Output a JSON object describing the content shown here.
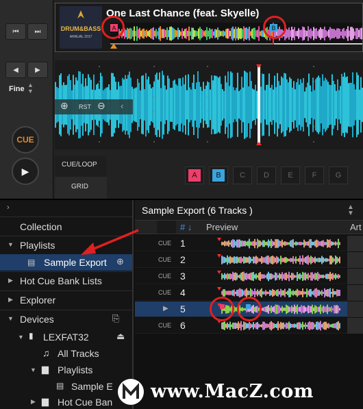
{
  "deck": {
    "transport": {
      "prev_icon": "skip-back-icon",
      "next_icon": "skip-forward-icon",
      "nudge_left_icon": "triangle-left-icon",
      "nudge_right_icon": "triangle-right-icon",
      "fine_label": "Fine",
      "cue_label": "CUE",
      "play_icon": "play-icon"
    },
    "track_title": "One Last Chance (feat. Skyelle)",
    "artwork_text": "DRUM&BASS",
    "artwork_sub": "ANNUAL 2017",
    "overview_markers": [
      "A",
      "B"
    ],
    "zoom": {
      "zoom_in_icon": "zoom-in-icon",
      "reset_label": "RST",
      "zoom_out_icon": "zoom-out-icon",
      "collapse_icon": "chevron-left-icon"
    },
    "tabs": {
      "cue_loop": "CUE/LOOP",
      "grid": "GRID"
    },
    "hot_cues": [
      {
        "label": "A",
        "color": "#ef3e6a",
        "set": true
      },
      {
        "label": "B",
        "color": "#3aa4e0",
        "set": true
      },
      {
        "label": "C",
        "set": false
      },
      {
        "label": "D",
        "set": false
      },
      {
        "label": "E",
        "set": false
      },
      {
        "label": "F",
        "set": false
      },
      {
        "label": "G",
        "set": false
      }
    ]
  },
  "browser": {
    "expand_icon": "chevron-right-icon",
    "tree": {
      "collection": "Collection",
      "playlists": "Playlists",
      "sample_export": "Sample Export",
      "hot_cue_bank_lists": "Hot Cue Bank Lists",
      "explorer": "Explorer",
      "devices": "Devices",
      "device_name": "LEXFAT32",
      "all_tracks": "All Tracks",
      "device_playlists": "Playlists",
      "device_sample": "Sample E",
      "device_hot_cue": "Hot Cue Ban"
    },
    "list_title": "Sample Export (6 Tracks )",
    "columns": {
      "num": "#",
      "preview": "Preview",
      "artwork": "Art"
    },
    "rows": [
      {
        "cue": "CUE",
        "num": "1",
        "selected": false
      },
      {
        "cue": "CUE",
        "num": "2",
        "selected": false
      },
      {
        "cue": "CUE",
        "num": "3",
        "selected": false
      },
      {
        "cue": "CUE",
        "num": "4",
        "selected": false
      },
      {
        "cue": "▶",
        "num": "5",
        "selected": true
      },
      {
        "cue": "CUE",
        "num": "6",
        "selected": false
      }
    ]
  },
  "watermark": {
    "text": "www.MacZ.com"
  },
  "colors": {
    "accent_red": "#e02020",
    "waveform_cyan": "#1fa8c8",
    "selection_blue": "#1f3e69",
    "cue_orange": "#e58a2c"
  }
}
